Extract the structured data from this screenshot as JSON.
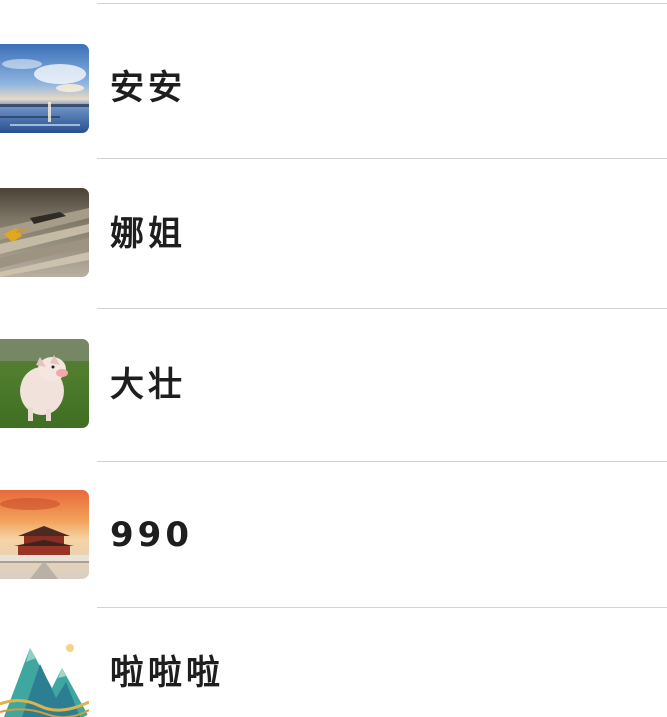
{
  "contacts": [
    {
      "name": "安安",
      "avatar": "seascape-sunset-image"
    },
    {
      "name": "娜姐",
      "avatar": "wooden-bench-leaf-image"
    },
    {
      "name": "大壮",
      "avatar": "piglet-on-grass-image"
    },
    {
      "name": "990",
      "avatar": "palace-sunset-image"
    },
    {
      "name": "啦啦啦",
      "avatar": "landscape-painting-image"
    }
  ],
  "colors": {
    "divider": "#d2d2d2",
    "text": "#1e1e1e",
    "background": "#ffffff"
  }
}
